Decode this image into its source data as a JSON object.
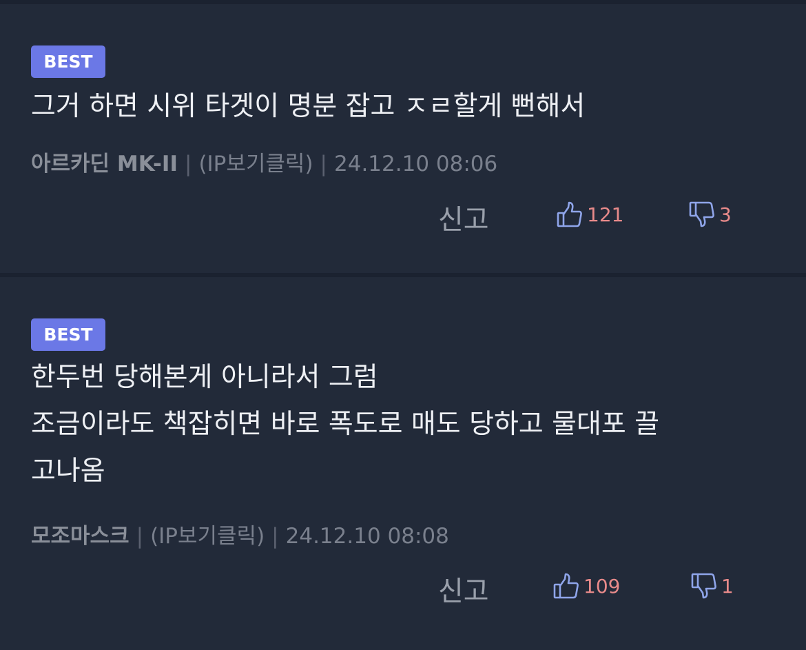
{
  "comments": [
    {
      "badge": "BEST",
      "text": "그거 하면 시위 타겟이 명분 잡고 ㅈㄹ할게 뻔해서",
      "author": "아르카딘 MK-II",
      "ip": "(IP보기클릭)",
      "timestamp": "24.12.10 08:06",
      "report_label": "신고",
      "likes": "121",
      "dislikes": "3"
    },
    {
      "badge": "BEST",
      "text": "한두번 당해본게 아니라서 그럼\n조금이라도 책잡히면 바로 폭도로 매도 당하고 물대포 끌\n고나옴",
      "author": "모조마스크",
      "ip": "(IP보기클릭)",
      "timestamp": "24.12.10 08:08",
      "report_label": "신고",
      "likes": "109",
      "dislikes": "1"
    }
  ],
  "separator": "|",
  "icons": {
    "like": "thumbs-up-icon",
    "dislike": "thumbs-down-icon"
  },
  "colors": {
    "background": "#222a39",
    "badge": "#6b78e6",
    "count": "#e88a8a",
    "icon": "#8fa5ea"
  }
}
